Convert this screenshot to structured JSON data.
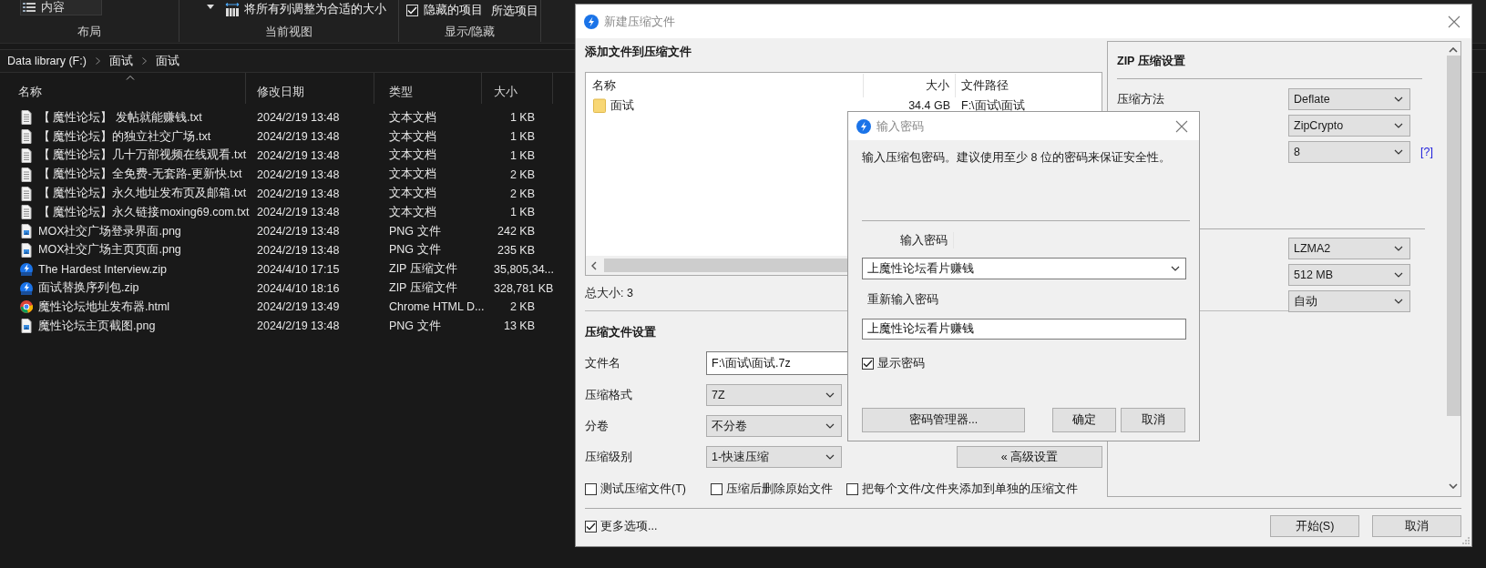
{
  "explorer": {
    "ribbon": {
      "layout_item": "内容",
      "fit_columns": "将所有列调整为合适的大小",
      "hidden_items": {
        "label": "隐藏的项目",
        "checked": true
      },
      "selected_items": "所选项目",
      "groups": [
        "布局",
        "当前视图",
        "显示/隐藏"
      ]
    },
    "breadcrumb": [
      "Data library (F:)",
      "面试",
      "面试"
    ],
    "columns": [
      {
        "label": "名称",
        "sorted": true
      },
      {
        "label": "修改日期",
        "sorted": false
      },
      {
        "label": "类型",
        "sorted": false
      },
      {
        "label": "大小",
        "sorted": false
      }
    ],
    "files": [
      {
        "name": "【 魔性论坛】 发帖就能赚钱.txt",
        "modified": "2024/2/19 13:48",
        "type": "文本文档",
        "size": "1 KB",
        "kind": "text"
      },
      {
        "name": "【 魔性论坛】的独立社交广场.txt",
        "modified": "2024/2/19 13:48",
        "type": "文本文档",
        "size": "1 KB",
        "kind": "text"
      },
      {
        "name": "【 魔性论坛】几十万部视频在线观看.txt",
        "modified": "2024/2/19 13:48",
        "type": "文本文档",
        "size": "1 KB",
        "kind": "text"
      },
      {
        "name": "【 魔性论坛】全免费-无套路-更新快.txt",
        "modified": "2024/2/19 13:48",
        "type": "文本文档",
        "size": "2 KB",
        "kind": "text"
      },
      {
        "name": "【 魔性论坛】永久地址发布页及邮箱.txt",
        "modified": "2024/2/19 13:48",
        "type": "文本文档",
        "size": "2 KB",
        "kind": "text"
      },
      {
        "name": "【 魔性论坛】永久链接moxing69.com.txt",
        "modified": "2024/2/19 13:48",
        "type": "文本文档",
        "size": "1 KB",
        "kind": "text"
      },
      {
        "name": "MOX社交广场登录界面.png",
        "modified": "2024/2/19 13:48",
        "type": "PNG 文件",
        "size": "242 KB",
        "kind": "image"
      },
      {
        "name": "MOX社交广场主页页面.png",
        "modified": "2024/2/19 13:48",
        "type": "PNG 文件",
        "size": "235 KB",
        "kind": "image"
      },
      {
        "name": "The Hardest Interview.zip",
        "modified": "2024/4/10 17:15",
        "type": "ZIP 压缩文件",
        "size": "35,805,34...",
        "kind": "zip"
      },
      {
        "name": "面试替换序列包.zip",
        "modified": "2024/4/10 18:16",
        "type": "ZIP 压缩文件",
        "size": "328,781 KB",
        "kind": "zip"
      },
      {
        "name": "魔性论坛地址发布器.html",
        "modified": "2024/2/19 13:49",
        "type": "Chrome HTML D...",
        "size": "2 KB",
        "kind": "browser"
      },
      {
        "name": "魔性论坛主页截图.png",
        "modified": "2024/2/19 13:48",
        "type": "PNG 文件",
        "size": "13 KB",
        "kind": "image"
      }
    ]
  },
  "archive_dialog": {
    "title": "新建压缩文件",
    "heading": "添加文件到压缩文件",
    "list_columns": [
      "名称",
      "大小",
      "文件路径"
    ],
    "list_rows": [
      {
        "name": "面试",
        "size": "34.4 GB",
        "path": "F:\\面试\\面试"
      }
    ],
    "total": "总大小: 3",
    "settings_title": "压缩文件设置",
    "fields": [
      {
        "label": "文件名",
        "kind": "text",
        "value": "F:\\面试\\面试.7z"
      },
      {
        "label": "压缩格式",
        "kind": "select",
        "value": "7Z"
      },
      {
        "label": "分卷",
        "kind": "select",
        "value": "不分卷"
      },
      {
        "label": "压缩级别",
        "kind": "select",
        "value": "1-快速压缩"
      }
    ],
    "advanced_button": "« 高级设置",
    "options": [
      {
        "label": "测试压缩文件(T)",
        "checked": false
      },
      {
        "label": "压缩后删除原始文件",
        "checked": false
      },
      {
        "label": "把每个文件/文件夹添加到单独的压缩文件",
        "checked": false
      }
    ],
    "more_options": {
      "label": "更多选项...",
      "checked": true
    },
    "buttons": [
      "开始(S)",
      "取消"
    ],
    "zip_panel": {
      "title": "ZIP 压缩设置",
      "rows": [
        {
          "label": "压缩方法",
          "value": "Deflate"
        },
        {
          "value": "ZipCrypto"
        },
        {
          "value": "8",
          "help": "[?]"
        }
      ],
      "rows_2": [
        {
          "value": "LZMA2"
        },
        {
          "value": "512 MB"
        },
        {
          "value": "自动"
        }
      ]
    }
  },
  "password_dialog": {
    "title": "输入密码",
    "message": "输入压缩包密码。建议使用至少 8 位的密码来保证安全性。",
    "password_label": "输入密码",
    "password": "上魔性论坛看片赚钱",
    "confirm_label": "重新输入密码",
    "confirm": "上魔性论坛看片赚钱",
    "show_password": {
      "label": "显示密码",
      "checked": true
    },
    "buttons": [
      "密码管理器...",
      "确定",
      "取消"
    ]
  }
}
